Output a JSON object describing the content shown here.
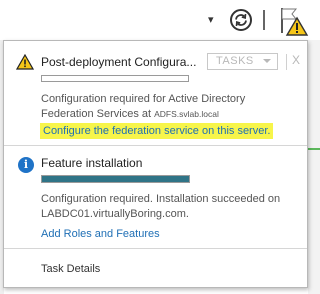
{
  "topbar": {
    "dropdown_icon": "chevron-down-icon",
    "refresh_icon": "refresh-icon",
    "flag_icon": "notification-flag-warning-icon"
  },
  "notifications": [
    {
      "icon": "warning-icon",
      "title": "Post-deployment Configura...",
      "tasks_label": "TASKS",
      "close_label": "X",
      "progress": 0,
      "desc_line1": "Configuration required for Active Directory",
      "desc_line2": "Federation Services at",
      "desc_small": "ADFS.svlab.local",
      "link": "Configure the federation service on this server."
    },
    {
      "icon": "info-icon",
      "title": "Feature installation",
      "progress": 1.0,
      "desc_line1": "Configuration required. Installation succeeded on",
      "desc_line2": "LABDC01.virtuallyBoring.com.",
      "link": "Add Roles and Features"
    }
  ],
  "footer": {
    "task_details": "Task Details"
  },
  "colors": {
    "link": "#1f6fb5",
    "highlight": "#f7f54a",
    "progress_fill": "#2f7487",
    "warning": "#f5c518"
  }
}
